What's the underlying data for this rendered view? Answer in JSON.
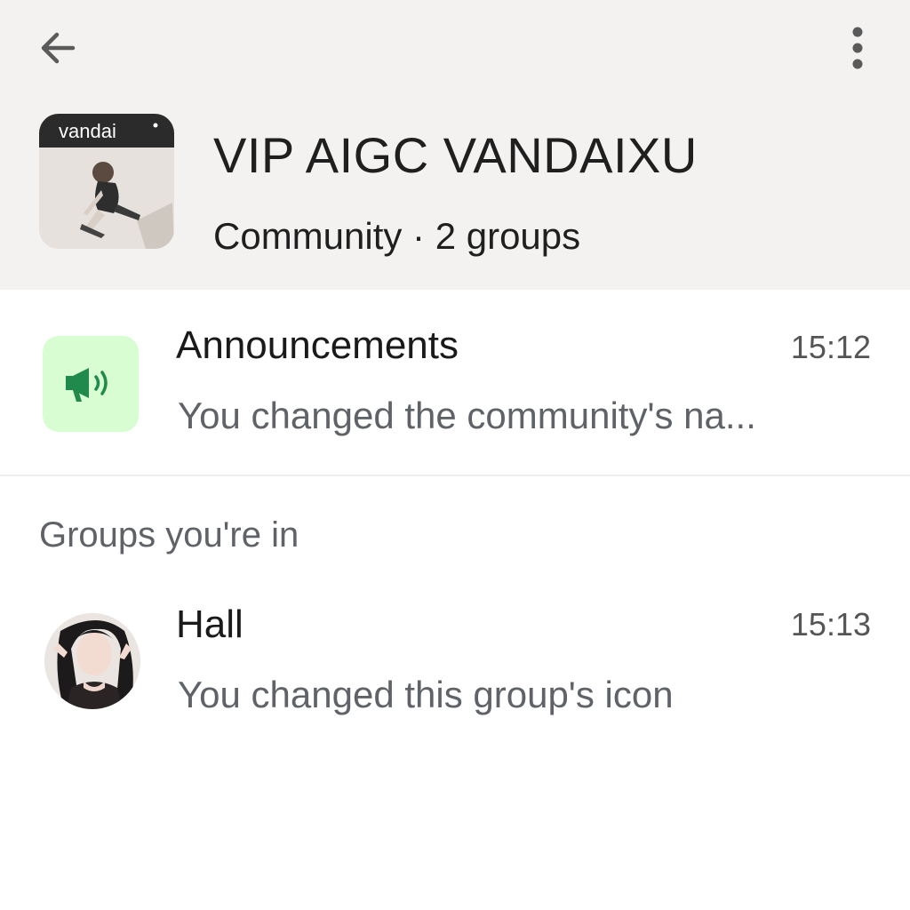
{
  "header": {
    "back_icon": "arrow-left-icon",
    "menu_icon": "more-vertical-icon",
    "avatar_brand_text": "vandai",
    "title": "VIP AIGC VANDAIXU",
    "subtitle": "Community · 2 groups",
    "background_color": "#f3f2f1"
  },
  "announcements": {
    "icon": "megaphone-icon",
    "icon_color": "#1f8a4c",
    "icon_background": "#d8fdd2",
    "name": "Announcements",
    "time": "15:12",
    "preview": "You changed the community's na..."
  },
  "groups_section": {
    "label": "Groups you're in"
  },
  "groups": [
    {
      "name": "Hall",
      "time": "15:13",
      "preview": "You changed this group's icon"
    }
  ]
}
